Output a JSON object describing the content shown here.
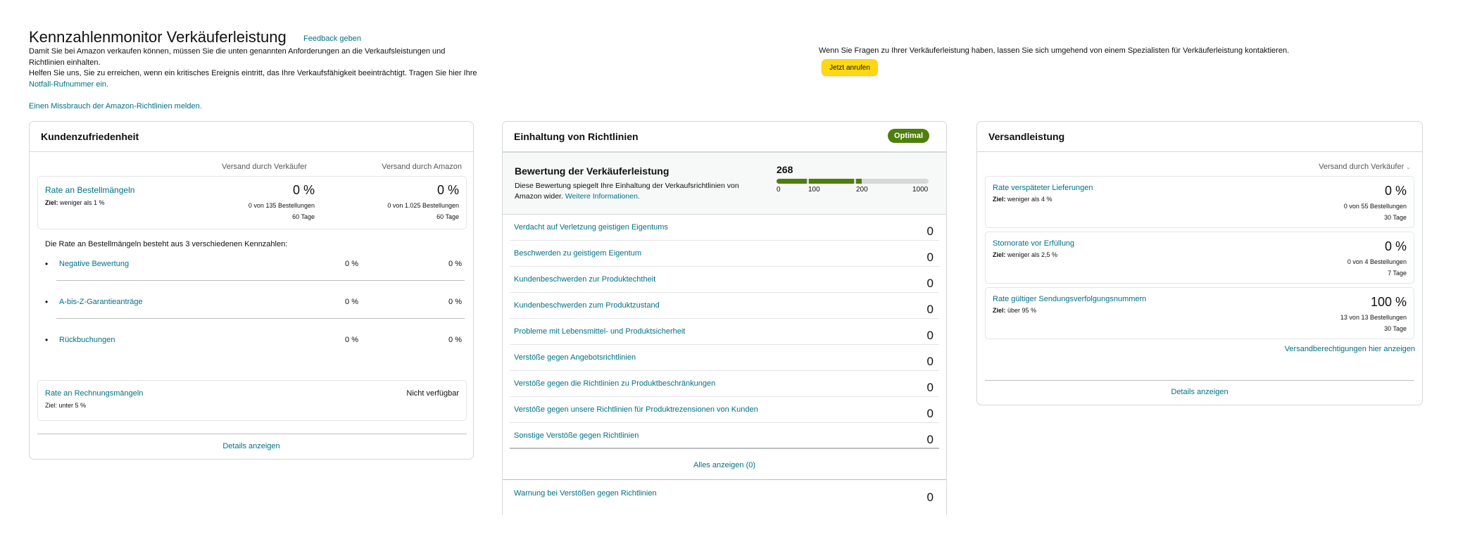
{
  "header": {
    "title": "Kennzahlenmonitor Verkäuferleistung",
    "feedback_link": "Feedback geben",
    "intro_line1": "Damit Sie bei Amazon verkaufen können, müssen Sie die unten genannten Anforderungen an die Verkaufsleistungen und Richtlinien einhalten.",
    "intro_line2_pre": "Helfen Sie uns, Sie zu erreichen, wenn ein kritisches Ereignis eintritt, das Ihre Verkaufsfähigkeit beeinträchtigt. Tragen Sie hier Ihre ",
    "intro_line2_link": "Notfall-Rufnummer ein.",
    "report_link": "Einen Missbrauch der Amazon-Richtlinien melden.",
    "contact_text": "Wenn Sie Fragen zu Ihrer Verkäuferleistung haben, lassen Sie sich umgehend von einem Spezialisten für Verkäuferleistung kontaktieren.",
    "call_button": "Jetzt anrufen"
  },
  "customer": {
    "title": "Kundenzufriedenheit",
    "col_seller": "Versand durch Verkäufer",
    "col_amazon": "Versand durch Amazon",
    "odr": {
      "title": "Rate an Bestellmängeln",
      "target_label": "Ziel:",
      "target_text": " weniger als 1 %",
      "seller_value": "0 %",
      "seller_count": "0 von 135 Bestellungen",
      "seller_period": "60 Tage",
      "amazon_value": "0 %",
      "amazon_count": "0 von 1.025 Bestellungen",
      "amazon_period": "60 Tage"
    },
    "breakdown_heading": "Die Rate an Bestellmängeln besteht aus 3 verschiedenen Kennzahlen:",
    "components": [
      {
        "label": "Negative Bewertung",
        "seller": "0 %",
        "amazon": "0 %"
      },
      {
        "label": "A-bis-Z-Garantieanträge",
        "seller": "0 %",
        "amazon": "0 %"
      },
      {
        "label": "Rückbuchungen",
        "seller": "0 %",
        "amazon": "0 %"
      }
    ],
    "invoice": {
      "title": "Rate an Rechnungsmängeln",
      "target": "Ziel: unter 5 %",
      "value": "Nicht verfügbar"
    },
    "details_link": "Details anzeigen"
  },
  "policy": {
    "title": "Einhaltung von Richtlinien",
    "badge": "Optimal",
    "score_title": "Bewertung der Verkäuferleistung",
    "score_desc": "Diese Bewertung spiegelt Ihre Einhaltung der Verkaufsrichtlinien von Amazon wider. ",
    "score_more": "Weitere Informationen.",
    "score_value": "268",
    "score_max": 1000,
    "scale_ticks": [
      "0",
      "100",
      "200",
      "1000"
    ],
    "rows": [
      {
        "label": "Verdacht auf Verletzung geistigen Eigentums",
        "count": "0"
      },
      {
        "label": "Beschwerden zu geistigem Eigentum",
        "count": "0"
      },
      {
        "label": "Kundenbeschwerden zur Produktechtheit",
        "count": "0"
      },
      {
        "label": "Kundenbeschwerden zum Produktzustand",
        "count": "0"
      },
      {
        "label": "Probleme mit Lebensmittel- und Produktsicherheit",
        "count": "0"
      },
      {
        "label": "Verstöße gegen Angebotsrichtlinien",
        "count": "0"
      },
      {
        "label": "Verstöße gegen die Richtlinien zu Produktbeschränkungen",
        "count": "0"
      },
      {
        "label": "Verstöße gegen unsere Richtlinien für Produktrezensionen von Kunden",
        "count": "0"
      },
      {
        "label": "Sonstige Verstöße gegen Richtlinien",
        "count": "0"
      }
    ],
    "all_link": "Alles anzeigen (0)",
    "warning": {
      "label": "Warnung bei Verstößen gegen Richtlinien",
      "count": "0"
    }
  },
  "shipping": {
    "title": "Versandleistung",
    "selector": "Versand durch Verkäufer",
    "metrics": [
      {
        "title": "Rate verspäteter Lieferungen",
        "target_label": "Ziel:",
        "target_text": " weniger als 4 %",
        "value": "0 %",
        "count": "0 von 55 Bestellungen",
        "period": "30 Tage"
      },
      {
        "title": "Stornorate vor Erfüllung",
        "target_label": "Ziel:",
        "target_text": " weniger als 2,5 %",
        "value": "0 %",
        "count": "0 von 4 Bestellungen",
        "period": "7 Tage"
      },
      {
        "title": "Rate gültiger Sendungsverfolgungsnummern",
        "target_label": "Ziel:",
        "target_text": " über 95 %",
        "value": "100 %",
        "count": "13 von 13 Bestellungen",
        "period": "30 Tage"
      }
    ],
    "permissions_link": "Versandberechtigungen hier anzeigen",
    "details_link": "Details anzeigen"
  },
  "colors": {
    "accent_link": "#007185",
    "badge_green": "#4e7f0c",
    "call_button": "#ffd814"
  }
}
